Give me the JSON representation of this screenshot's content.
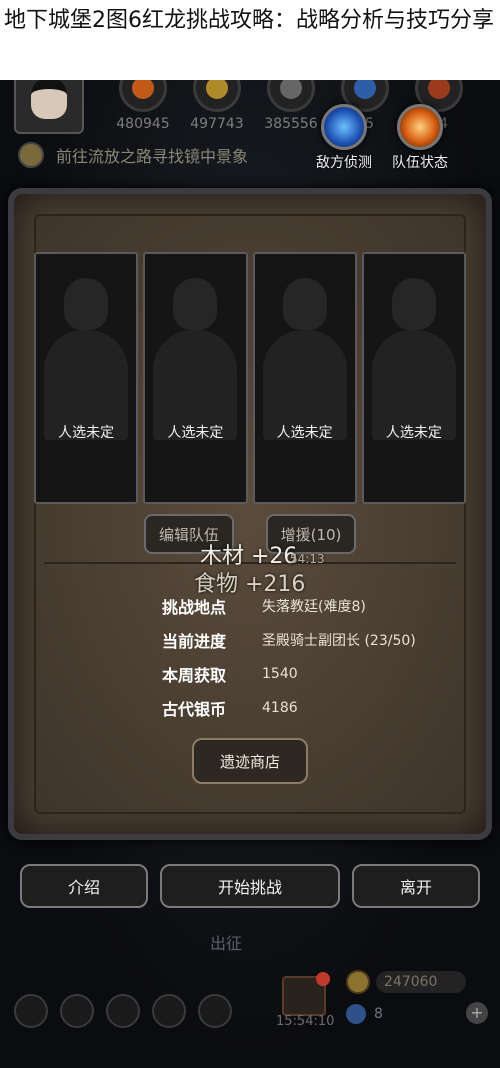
{
  "article": {
    "title": "地下城堡2图6红龙挑战攻略：战略分析与技巧分享"
  },
  "top_resources": [
    {
      "icon": "fire-orb-icon",
      "value": "480945"
    },
    {
      "icon": "gold-ingot-icon",
      "value": "497743"
    },
    {
      "icon": "iron-icon",
      "value": "385556"
    },
    {
      "icon": "blue-crystal-icon",
      "value": "35"
    },
    {
      "icon": "red-crystal-icon",
      "value": "34"
    }
  ],
  "header_buttons": {
    "scout_label": "敌方侦测",
    "team_status_label": "队伍状态"
  },
  "quest": {
    "text": "前往流放之路寻找镜中景象"
  },
  "team_slots": [
    {
      "label": "人选未定"
    },
    {
      "label": "人选未定"
    },
    {
      "label": "人选未定"
    },
    {
      "label": "人选未定"
    }
  ],
  "team_buttons": {
    "edit_label": "编辑队伍",
    "reinforce_label": "增援(10)"
  },
  "floating": {
    "wood": "木材 +26",
    "timer": "54:13",
    "food": "食物 +216"
  },
  "challenge_info": [
    {
      "key": "挑战地点",
      "value": "失落教廷(难度8)"
    },
    {
      "key": "当前进度",
      "value": "圣殿骑士副团长 (23/50)"
    },
    {
      "key": "本周获取",
      "value": "1540"
    },
    {
      "key": "古代银币",
      "value": "4186"
    }
  ],
  "shop_label": "遗迹商店",
  "bottom_buttons": {
    "intro": "介绍",
    "start": "开始挑战",
    "leave": "离开"
  },
  "deploy_label": "出征",
  "footer": {
    "chest_time": "15:54:10",
    "gold": "247060",
    "gems": "8",
    "plus": "+"
  },
  "colors": {
    "panel": "#4a3f33",
    "slot_bg": "#151515",
    "text_light": "#f0f0f0"
  }
}
